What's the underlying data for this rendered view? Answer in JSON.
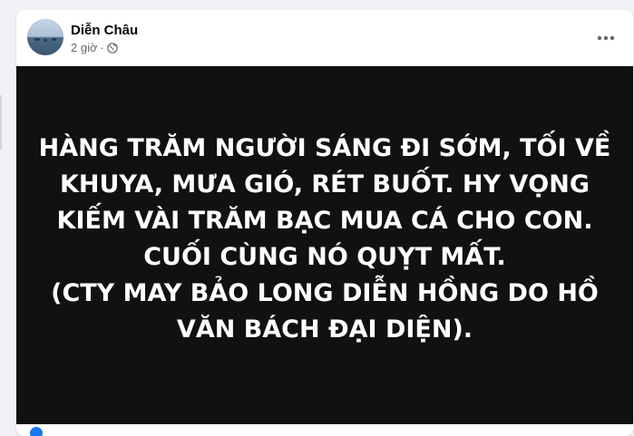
{
  "post": {
    "author_name": "Diễn Châu",
    "timestamp": "2 giờ",
    "separator": "·",
    "privacy_icon": "globe-icon",
    "more_icon": "more-options-icon",
    "image_text": {
      "line1": "HÀNG TRĂM NGƯỜI SÁNG ĐI SỚM, TỐI VỀ",
      "line2": "KHUYA, MƯA GIÓ, RÉT BUỐT. HY VỌNG",
      "line3": "KIẾM VÀI TRĂM BẠC MUA CÁ CHO CON.",
      "line4": "CUỐI CÙNG NÓ QUỴT MẤT.",
      "line5": "(CTY MAY BẢO LONG DIỄN HỒNG DO HỒ",
      "line6": "VĂN BÁCH ĐẠI DIỆN)."
    }
  },
  "colors": {
    "image_background": "#111111",
    "image_text": "#ffffff",
    "secondary_text": "#65676b",
    "primary_text": "#050505",
    "accent": "#1877f2"
  }
}
